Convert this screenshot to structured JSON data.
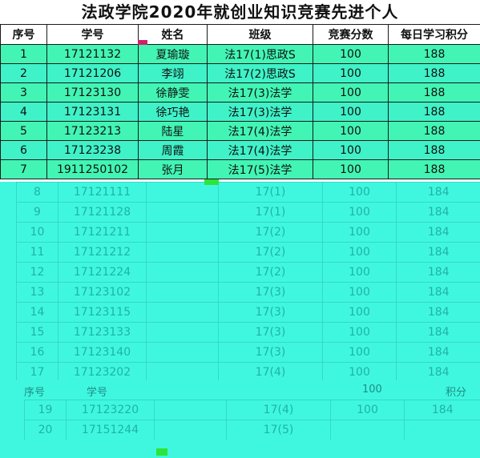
{
  "title": "法政学院2020年就创业知识竞赛先进个人",
  "headers": [
    "序号",
    "学号",
    "姓名",
    "班级",
    "竞赛分数",
    "每日学习积分"
  ],
  "rows": [
    {
      "no": "1",
      "id": "17121132",
      "name": "夏瑜璇",
      "cls": "法17(1)思政S",
      "score": "100",
      "points": "188"
    },
    {
      "no": "2",
      "id": "17121206",
      "name": "李翊",
      "cls": "法17(2)思政S",
      "score": "100",
      "points": "188"
    },
    {
      "no": "3",
      "id": "17123130",
      "name": "徐静雯",
      "cls": "法17(3)法学",
      "score": "100",
      "points": "188"
    },
    {
      "no": "4",
      "id": "17123131",
      "name": "徐巧艳",
      "cls": "法17(3)法学",
      "score": "100",
      "points": "188"
    },
    {
      "no": "5",
      "id": "17123213",
      "name": "陆星",
      "cls": "法17(4)法学",
      "score": "100",
      "points": "188"
    },
    {
      "no": "6",
      "id": "17123238",
      "name": "周霞",
      "cls": "法17(4)法学",
      "score": "100",
      "points": "188"
    },
    {
      "no": "7",
      "id": "1911250102",
      "name": "张月",
      "cls": "法17(5)法学",
      "score": "100",
      "points": "188"
    }
  ],
  "faded_rows": [
    {
      "no": "8",
      "id": "17121111",
      "name": "",
      "cls": "17(1)",
      "score": "100",
      "points": "184"
    },
    {
      "no": "9",
      "id": "17121128",
      "name": "",
      "cls": "17(1)",
      "score": "100",
      "points": "184"
    },
    {
      "no": "10",
      "id": "17121211",
      "name": "",
      "cls": "17(2)",
      "score": "100",
      "points": "184"
    },
    {
      "no": "11",
      "id": "17121212",
      "name": "",
      "cls": "17(2)",
      "score": "100",
      "points": "184"
    },
    {
      "no": "12",
      "id": "17121224",
      "name": "",
      "cls": "17(2)",
      "score": "100",
      "points": "184"
    },
    {
      "no": "13",
      "id": "17123102",
      "name": "",
      "cls": "17(3)",
      "score": "100",
      "points": "184"
    },
    {
      "no": "14",
      "id": "17123115",
      "name": "",
      "cls": "17(3)",
      "score": "100",
      "points": "184"
    },
    {
      "no": "15",
      "id": "17123133",
      "name": "",
      "cls": "17(3)",
      "score": "100",
      "points": "184"
    },
    {
      "no": "16",
      "id": "17123140",
      "name": "",
      "cls": "17(3)",
      "score": "100",
      "points": "184"
    },
    {
      "no": "17",
      "id": "17123202",
      "name": "",
      "cls": "17(4)",
      "score": "100",
      "points": "184"
    }
  ],
  "repeat_header": {
    "no": "序号",
    "id": "学号",
    "score": "100",
    "points": "积分"
  },
  "tail_rows": [
    {
      "no": "19",
      "id": "17123220",
      "name": "",
      "cls": "17(4)",
      "score": "100",
      "points": "184"
    },
    {
      "no": "20",
      "id": "17151244",
      "name": "",
      "cls": "17(5)",
      "score": "",
      "points": ""
    }
  ]
}
